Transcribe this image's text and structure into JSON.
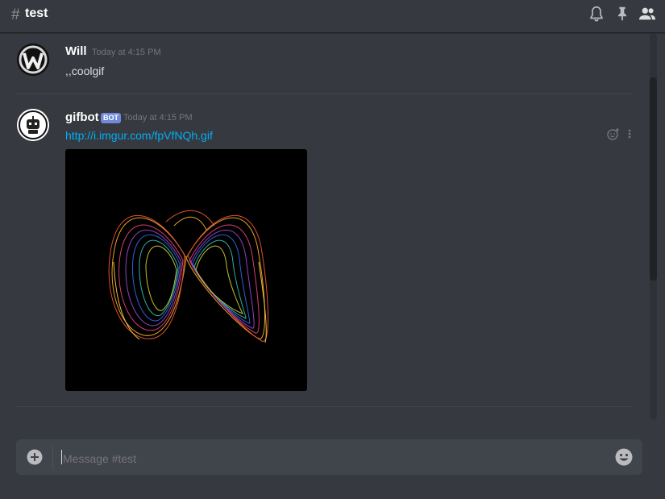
{
  "header": {
    "hash": "#",
    "channel": "test"
  },
  "messages": [
    {
      "author": "Will",
      "timestamp": "Today at 4:15 PM",
      "text": ",,coolgif"
    },
    {
      "author": "gifbot",
      "badge": "BOT",
      "timestamp": "Today at 4:15 PM",
      "link": "http://i.imgur.com/fpVfNQh.gif"
    }
  ],
  "composer": {
    "placeholder": "Message #test"
  },
  "colors": {
    "background": "#36393f",
    "link": "#00b0f4",
    "bot_badge": "#7289da"
  },
  "icons": [
    "bell-icon",
    "pin-icon",
    "members-icon",
    "add-reaction-icon",
    "more-options-icon",
    "plus-icon",
    "emoji-icon"
  ]
}
